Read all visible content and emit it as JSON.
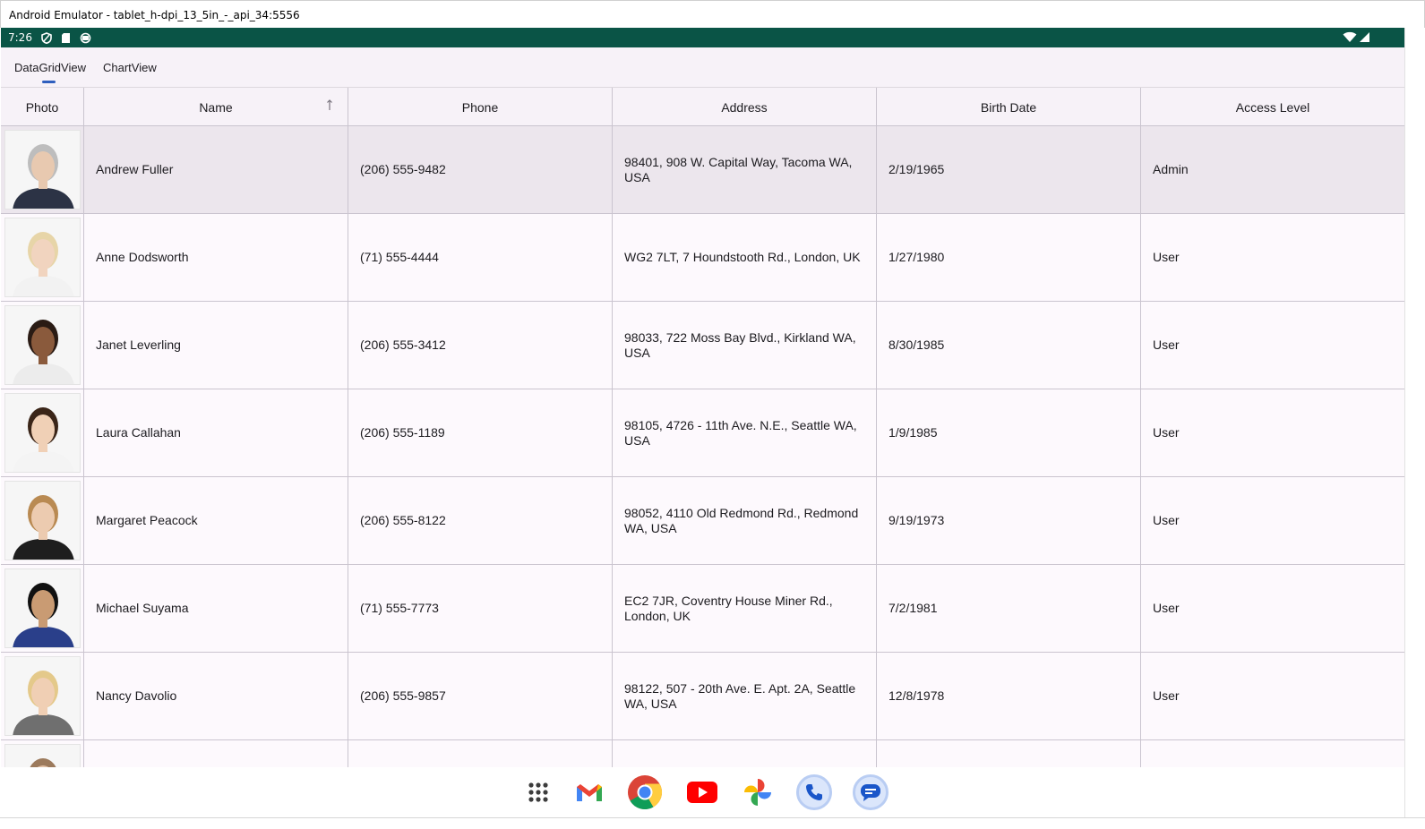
{
  "window": {
    "title": "Android Emulator - tablet_h-dpi_13_5in_-_api_34:5556"
  },
  "status_bar": {
    "time": "7:26",
    "icons": [
      "shield-icon",
      "sd-card-icon",
      "sync-icon",
      "wifi-icon",
      "signal-icon"
    ]
  },
  "tabs": [
    {
      "label": "DataGridView",
      "selected": true
    },
    {
      "label": "ChartView",
      "selected": false
    }
  ],
  "grid": {
    "columns": [
      "Photo",
      "Name",
      "Phone",
      "Address",
      "Birth Date",
      "Access Level"
    ],
    "sort_column": "Name",
    "sort_direction": "ascending",
    "rows": [
      {
        "name": "Andrew Fuller",
        "phone": "(206) 555-9482",
        "address": "98401, 908 W. Capital Way, Tacoma WA, USA",
        "birth_date": "2/19/1965",
        "access": "Admin",
        "selected": true
      },
      {
        "name": "Anne Dodsworth",
        "phone": "(71) 555-4444",
        "address": "WG2 7LT, 7 Houndstooth Rd., London, UK",
        "birth_date": "1/27/1980",
        "access": "User"
      },
      {
        "name": "Janet Leverling",
        "phone": "(206) 555-3412",
        "address": "98033, 722 Moss Bay Blvd., Kirkland WA, USA",
        "birth_date": "8/30/1985",
        "access": "User"
      },
      {
        "name": "Laura Callahan",
        "phone": "(206) 555-1189",
        "address": "98105, 4726 - 11th Ave. N.E., Seattle WA, USA",
        "birth_date": "1/9/1985",
        "access": "User"
      },
      {
        "name": "Margaret Peacock",
        "phone": "(206) 555-8122",
        "address": "98052, 4110 Old Redmond Rd., Redmond WA, USA",
        "birth_date": "9/19/1973",
        "access": "User"
      },
      {
        "name": "Michael Suyama",
        "phone": "(71) 555-7773",
        "address": "EC2 7JR, Coventry House Miner Rd., London, UK",
        "birth_date": "7/2/1981",
        "access": "User"
      },
      {
        "name": "Nancy Davolio",
        "phone": "(206) 555-9857",
        "address": "98122, 507 - 20th Ave. E. Apt. 2A, Seattle WA, USA",
        "birth_date": "12/8/1978",
        "access": "User"
      },
      {
        "name": "",
        "phone": "",
        "address": "",
        "birth_date": "",
        "access": ""
      }
    ]
  },
  "dock": [
    "app-drawer-icon",
    "gmail-icon",
    "chrome-icon",
    "youtube-icon",
    "photos-icon",
    "phone-icon",
    "messages-icon"
  ],
  "colors": {
    "status_bar": "#0a5446",
    "tab_indicator": "#2f5fbe",
    "grid_bg": "#fdf9fd",
    "header_bg": "#f7f2f8",
    "selected_row": "#ece6ed"
  }
}
